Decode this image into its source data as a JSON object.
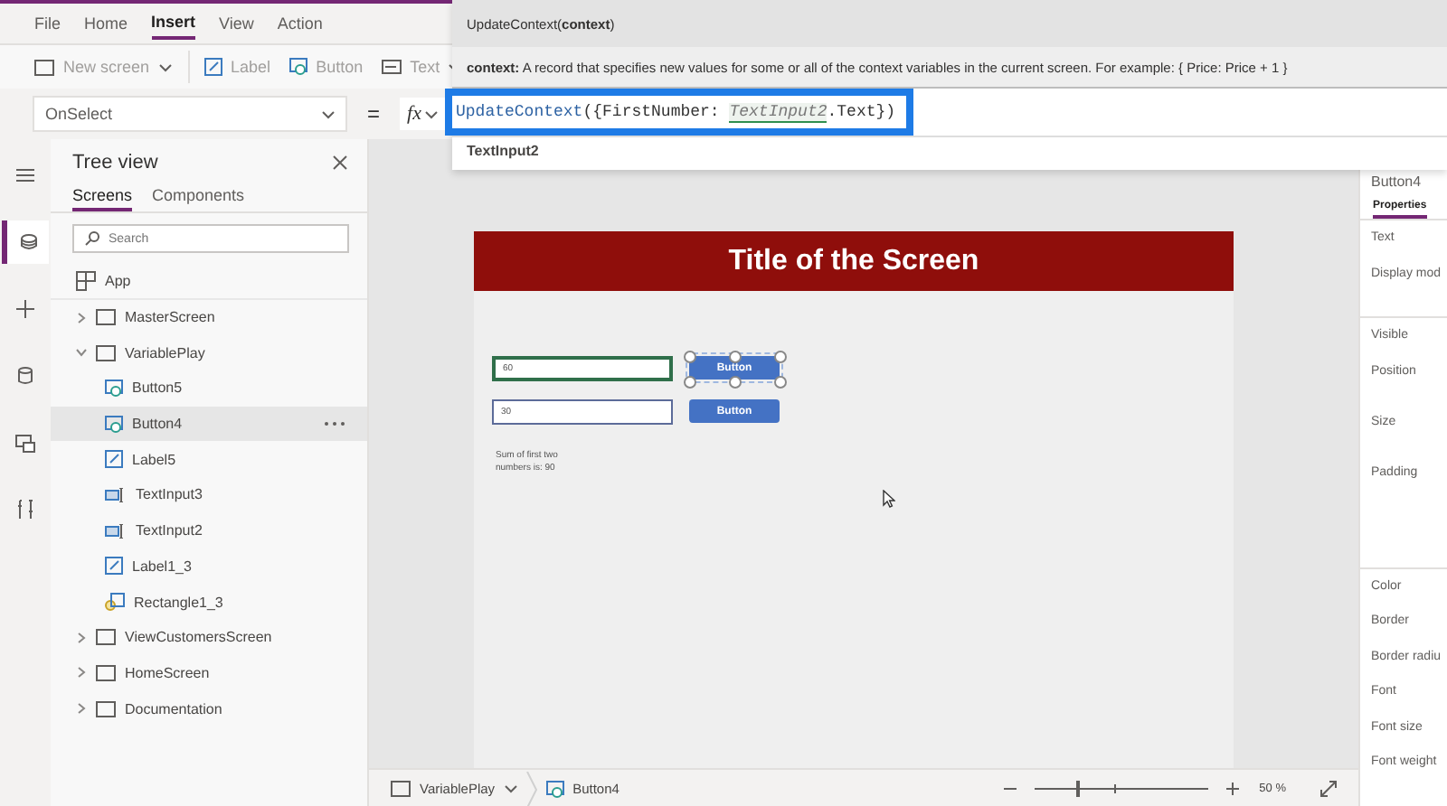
{
  "menu": [
    {
      "label": "File",
      "selected": false
    },
    {
      "label": "Home",
      "selected": false
    },
    {
      "label": "Insert",
      "selected": true
    },
    {
      "label": "View",
      "selected": false
    },
    {
      "label": "Action",
      "selected": false
    }
  ],
  "toolbar": [
    {
      "label": "New screen",
      "kind": "screen",
      "dropdown": true
    },
    {
      "label": "Label",
      "kind": "label",
      "dropdown": false
    },
    {
      "label": "Button",
      "kind": "button",
      "dropdown": false
    },
    {
      "label": "Text",
      "kind": "text",
      "dropdown": true
    }
  ],
  "formula_bar": {
    "property": "OnSelect",
    "equals": "=",
    "fx": "fx"
  },
  "intellisense": {
    "signature": "UpdateContext(**context**)",
    "description": "**context:** A record that specifies new values for some or all of the context variables in the current screen. For example: { Price: Price + 1 }",
    "code": [
      {
        "text": "UpdateContext",
        "kind": "function"
      },
      {
        "text": "({FirstNumber: ",
        "kind": "plain"
      },
      {
        "text": "TextInput2",
        "kind": "reference"
      },
      {
        "text": ".Text})",
        "kind": "plain"
      }
    ],
    "suggestion": "TextInput2"
  },
  "rail": [
    {
      "kind": "menu",
      "selected": false
    },
    {
      "kind": "layers",
      "selected": true
    },
    {
      "kind": "insert",
      "selected": false
    },
    {
      "kind": "data",
      "selected": false
    },
    {
      "kind": "media",
      "selected": false
    },
    {
      "kind": "tools",
      "selected": false
    }
  ],
  "tree_view": {
    "title": "Tree view",
    "tabs": [
      {
        "label": "Screens",
        "selected": true
      },
      {
        "label": "Components",
        "selected": false
      }
    ],
    "search": {
      "placeholder": "Search"
    },
    "items": [
      {
        "label": "App",
        "kind": "app",
        "selected": false
      },
      {
        "label": "MasterScreen",
        "kind": "screen",
        "selected": false,
        "expanded": false
      },
      {
        "label": "VariablePlay",
        "kind": "screen",
        "selected": false,
        "expanded": true,
        "children": [
          {
            "label": "Button5",
            "kind": "button",
            "selected": false
          },
          {
            "label": "Button4",
            "kind": "button",
            "selected": true
          },
          {
            "label": "Label5",
            "kind": "label",
            "selected": false
          },
          {
            "label": "TextInput3",
            "kind": "input",
            "selected": false
          },
          {
            "label": "TextInput2",
            "kind": "input",
            "selected": false
          },
          {
            "label": "Label1_3",
            "kind": "label",
            "selected": false
          },
          {
            "label": "Rectangle1_3",
            "kind": "rectangle",
            "selected": false
          }
        ]
      },
      {
        "label": "ViewCustomersScreen",
        "kind": "screen",
        "selected": false,
        "expanded": false
      },
      {
        "label": "HomeScreen",
        "kind": "screen",
        "selected": false,
        "expanded": false
      },
      {
        "label": "Documentation",
        "kind": "screen",
        "selected": false,
        "expanded": false
      }
    ]
  },
  "screen": {
    "title": "Title of the Screen",
    "controls": [
      {
        "kind": "input",
        "value": "60",
        "focused": true
      },
      {
        "kind": "button",
        "label": "Button",
        "selected": true
      },
      {
        "kind": "input",
        "value": "30",
        "focused": false
      },
      {
        "kind": "button",
        "label": "Button",
        "selected": false
      },
      {
        "kind": "label",
        "text": "Sum of first two numbers is: 90"
      }
    ]
  },
  "breadcrumb": [
    {
      "label": "VariablePlay",
      "kind": "screen"
    },
    {
      "label": "Button4",
      "kind": "button"
    }
  ],
  "zoom": {
    "level": 0.24,
    "reading": "50 %"
  },
  "properties": {
    "title": "Button4",
    "tabs": [
      {
        "label": "Properties",
        "selected": true
      }
    ],
    "groups": [
      [
        {
          "label": "Text",
          "kind": "line"
        },
        {
          "label": "Display mod",
          "kind": "line"
        }
      ],
      [
        {
          "label": "Visible",
          "kind": "line"
        },
        {
          "label": "Position",
          "kind": "pair"
        },
        {
          "label": "Size",
          "kind": "pair"
        },
        {
          "label": "Padding",
          "kind": "quad"
        }
      ],
      [
        {
          "label": "Color",
          "kind": "line"
        },
        {
          "label": "Border",
          "kind": "line"
        },
        {
          "label": "Border radiu",
          "kind": "line"
        },
        {
          "label": "Font",
          "kind": "line"
        },
        {
          "label": "Font size",
          "kind": "line"
        },
        {
          "label": "Font weight",
          "kind": "line"
        }
      ]
    ]
  }
}
